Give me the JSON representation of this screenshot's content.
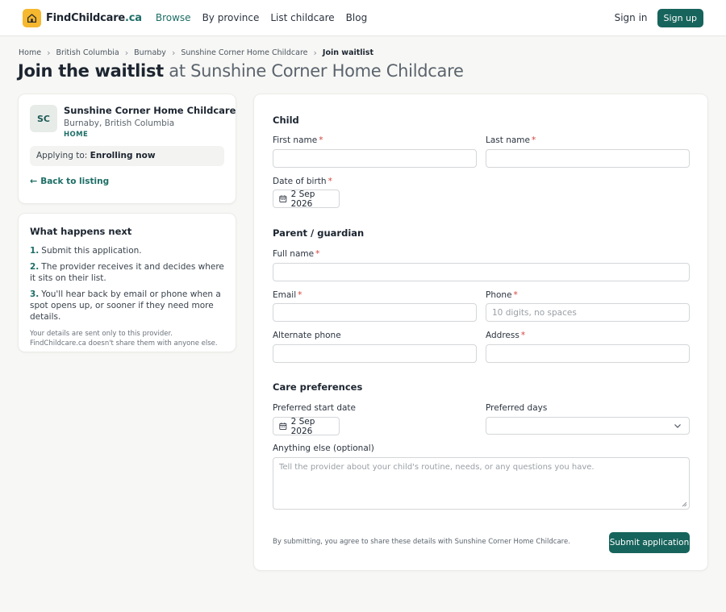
{
  "header": {
    "logo_name": "FindChildcare",
    "logo_tld": ".ca",
    "nav": [
      "Browse",
      "By province",
      "List childcare",
      "Blog"
    ],
    "sign_in": "Sign in",
    "sign_up": "Sign up",
    "brand_color": "#17645c",
    "logo_color": "#f5b82e"
  },
  "breadcrumb": [
    "Home",
    "British Columbia",
    "Burnaby",
    "Sunshine Corner Home Childcare",
    "Join waitlist"
  ],
  "title": {
    "strong": "Join the waitlist",
    "rest": " at Sunshine Corner Home Childcare"
  },
  "provider": {
    "initials": "SC",
    "name": "Sunshine Corner Home Childcare",
    "location": "Burnaby, British Columbia",
    "type": "HOME",
    "applying_label": "Applying to: ",
    "applying_value": "Enrolling now",
    "back_link": "Back to listing"
  },
  "next": {
    "title": "What happens next",
    "steps": [
      {
        "num": "1.",
        "text": "Submit this application."
      },
      {
        "num": "2.",
        "text": "The provider receives it and decides where it sits on their list."
      },
      {
        "num": "3.",
        "text": "You'll hear back by email or phone when a spot opens up, or sooner if they need more details."
      }
    ],
    "note": "Your details are sent only to this provider. FindChildcare.ca doesn't share them with anyone else."
  },
  "form": {
    "child_title": "Child",
    "first_name_label": "First name",
    "last_name_label": "Last name",
    "dob_label": "Date of birth",
    "dob_value": "2 Sep 2026",
    "parent_title": "Parent / guardian",
    "full_name_label": "Full name",
    "email_label": "Email",
    "phone_label": "Phone",
    "phone_placeholder": "10 digits, no spaces",
    "alt_phone_label": "Alternate phone",
    "address_label": "Address",
    "care_title": "Care preferences",
    "start_date_label": "Preferred start date",
    "start_date_value": "2 Sep 2026",
    "days_label": "Preferred days",
    "days_value": "",
    "notes_label": "Anything else (optional)",
    "notes_placeholder": "Tell the provider about your child's routine, needs, or any questions you have.",
    "required_mark": "*",
    "terms": "By submitting, you agree to share these details with Sunshine Corner Home Childcare.",
    "submit": "Submit application"
  }
}
